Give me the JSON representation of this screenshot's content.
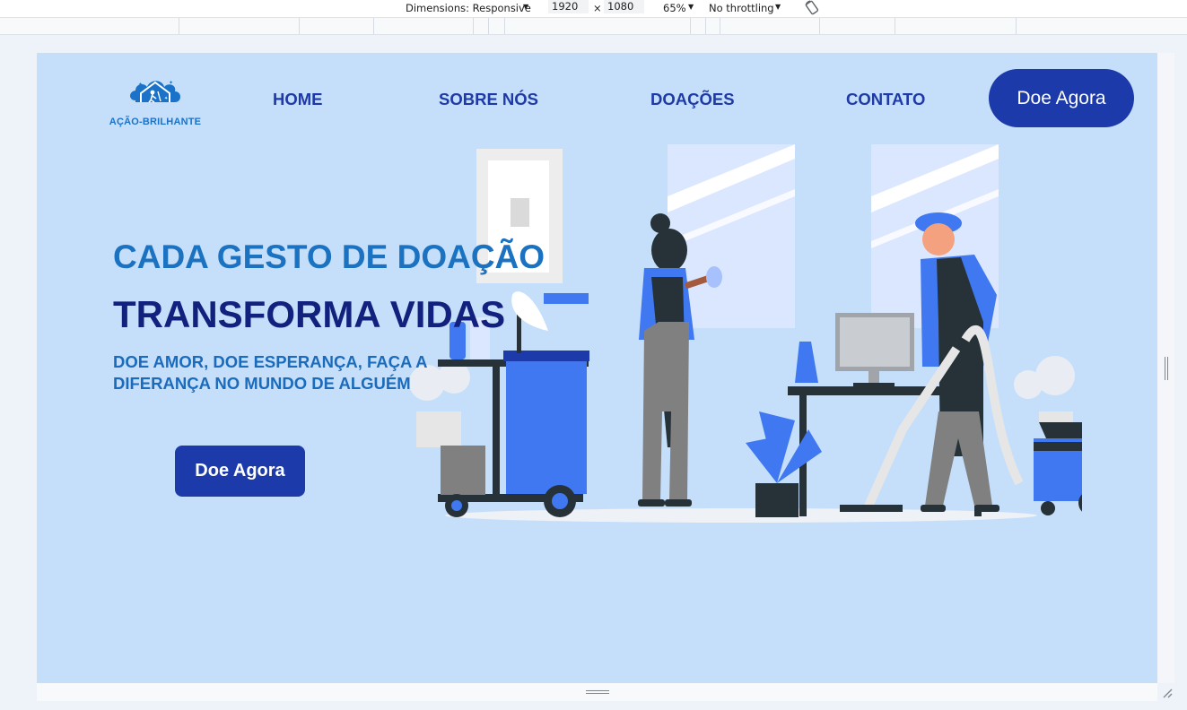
{
  "devtools": {
    "dimensions_label": "Dimensions: Responsive",
    "width": "1920",
    "times": "×",
    "height": "1080",
    "zoom": "65%",
    "throttling": "No throttling",
    "dropdown_caret": "▼"
  },
  "site": {
    "logo_text": "AÇÃO-BRILHANTE",
    "nav": {
      "home": "HOME",
      "about": "SOBRE NÓS",
      "donations": "DOAÇÕES",
      "contact": "CONTATO"
    },
    "nav_cta": "Doe Agora",
    "hero": {
      "title_line1": "CADA GESTO DE DOAÇÃO",
      "title_line2": "TRANSFORMA VIDAS",
      "subtitle_line1": "DOE AMOR, DOE ESPERANÇA, FAÇA A",
      "subtitle_line2": "DIFERANÇA NO MUNDO DE ALGUÉM",
      "cta": "Doe Agora"
    }
  },
  "colors": {
    "page_bg": "#c5dffb",
    "primary": "#1c3aa9",
    "title_light": "#1b72c1",
    "title_dark": "#12207e",
    "illustration_blue": "#3f78f0"
  },
  "icons": {
    "logo": "house-cleaning-logo-icon",
    "rotate": "rotate-device-icon",
    "resize_corner": "resize-corner-icon"
  }
}
